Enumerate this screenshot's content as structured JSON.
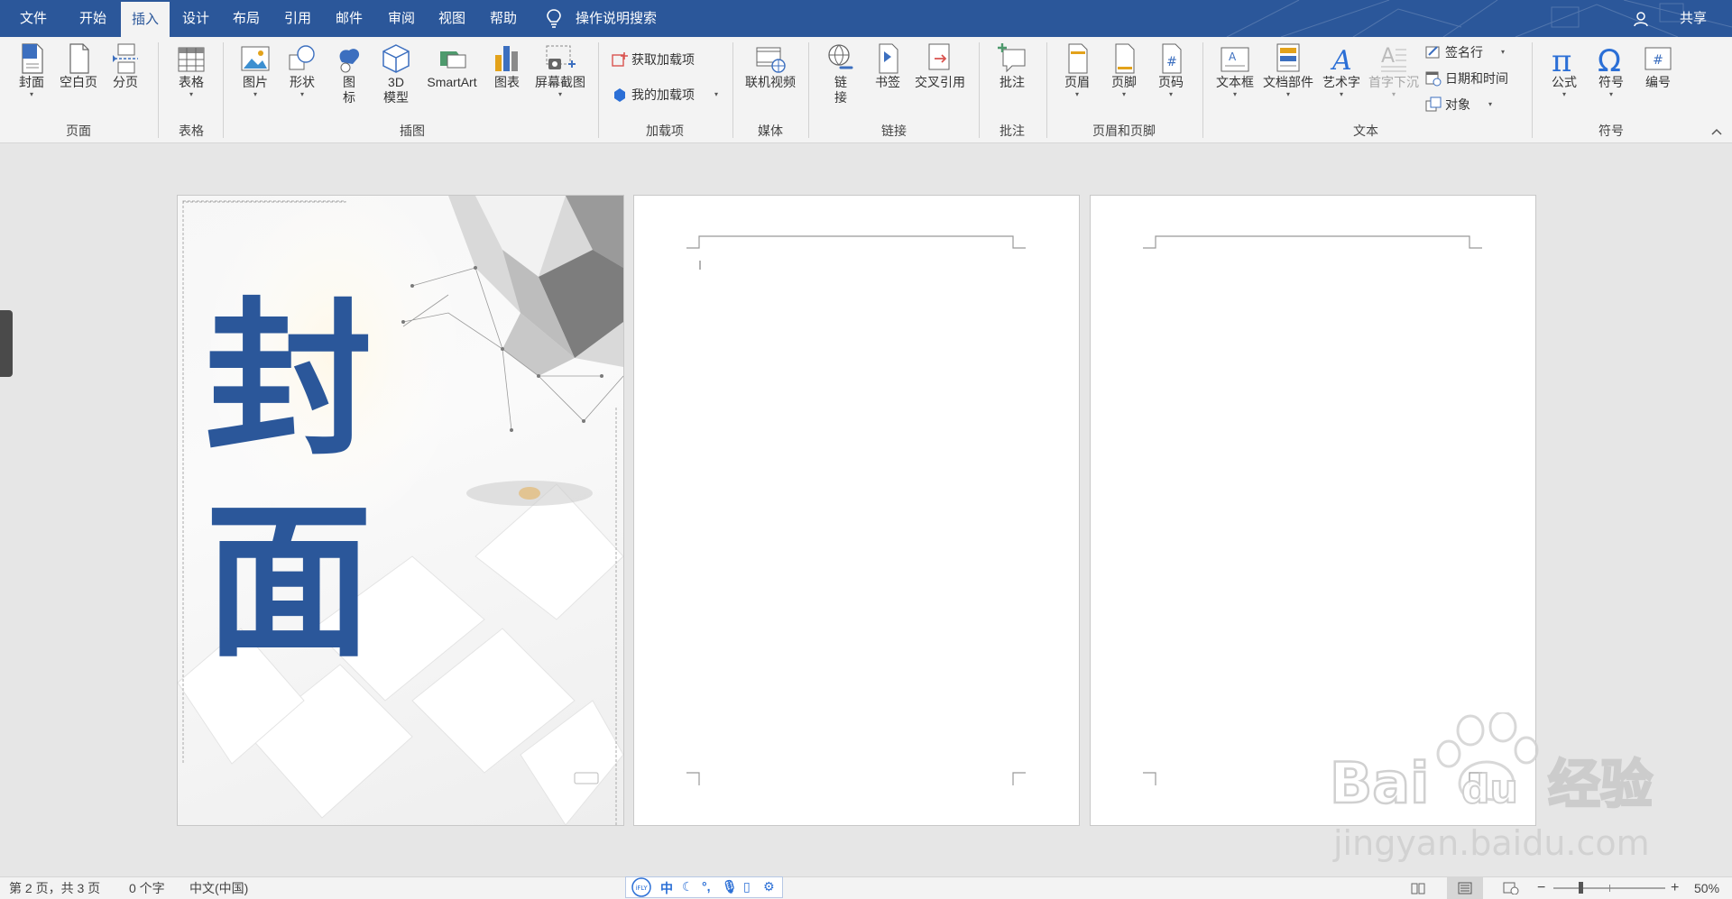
{
  "menu": {
    "tabs": [
      "文件",
      "开始",
      "插入",
      "设计",
      "布局",
      "引用",
      "邮件",
      "审阅",
      "视图",
      "帮助"
    ],
    "active_tab": "插入",
    "search": "操作说明搜索",
    "share": "共享"
  },
  "ribbon": {
    "groups": {
      "pages": "页面",
      "tables": "表格",
      "illustrations": "插图",
      "addins": "加载项",
      "media": "媒体",
      "links": "链接",
      "comments": "批注",
      "header_footer": "页眉和页脚",
      "text": "文本",
      "symbols": "符号"
    },
    "buttons": {
      "cover": "封面",
      "blank_page": "空白页",
      "page_break": "分页",
      "table": "表格",
      "picture": "图片",
      "shapes": "形状",
      "icons_1": "图",
      "icons_2": "标",
      "model3d_1": "3D",
      "model3d_2": "模型",
      "smartart": "SmartArt",
      "chart": "图表",
      "screenshot": "屏幕截图",
      "get_addins": "获取加载项",
      "my_addins": "我的加载项",
      "online_video": "联机视频",
      "link_1": "链",
      "link_2": "接",
      "bookmark": "书签",
      "cross_ref": "交叉引用",
      "comment": "批注",
      "header": "页眉",
      "footer": "页脚",
      "page_number": "页码",
      "text_box": "文本框",
      "quick_parts": "文档部件",
      "wordart": "艺术字",
      "drop_cap": "首字下沉",
      "signature": "签名行",
      "date_time": "日期和时间",
      "object": "对象",
      "equation": "公式",
      "symbol": "符号",
      "numbering": "编号"
    }
  },
  "document": {
    "cover_char_1": "封",
    "cover_char_2": "面"
  },
  "statusbar": {
    "page_info": "第 2 页，共 3 页",
    "word_count": "0 个字",
    "language": "中文(中国)",
    "zoom": "50%",
    "ime_logo": "iFLY",
    "ime_mode": "中"
  },
  "watermark": {
    "text1": "Bai",
    "text2": "du",
    "text3": "经验",
    "url": "jingyan.baidu.com"
  },
  "colors": {
    "brand": "#2b579a",
    "ribbon_bg": "#f3f3f3",
    "workspace_bg": "#e6e6e6"
  }
}
